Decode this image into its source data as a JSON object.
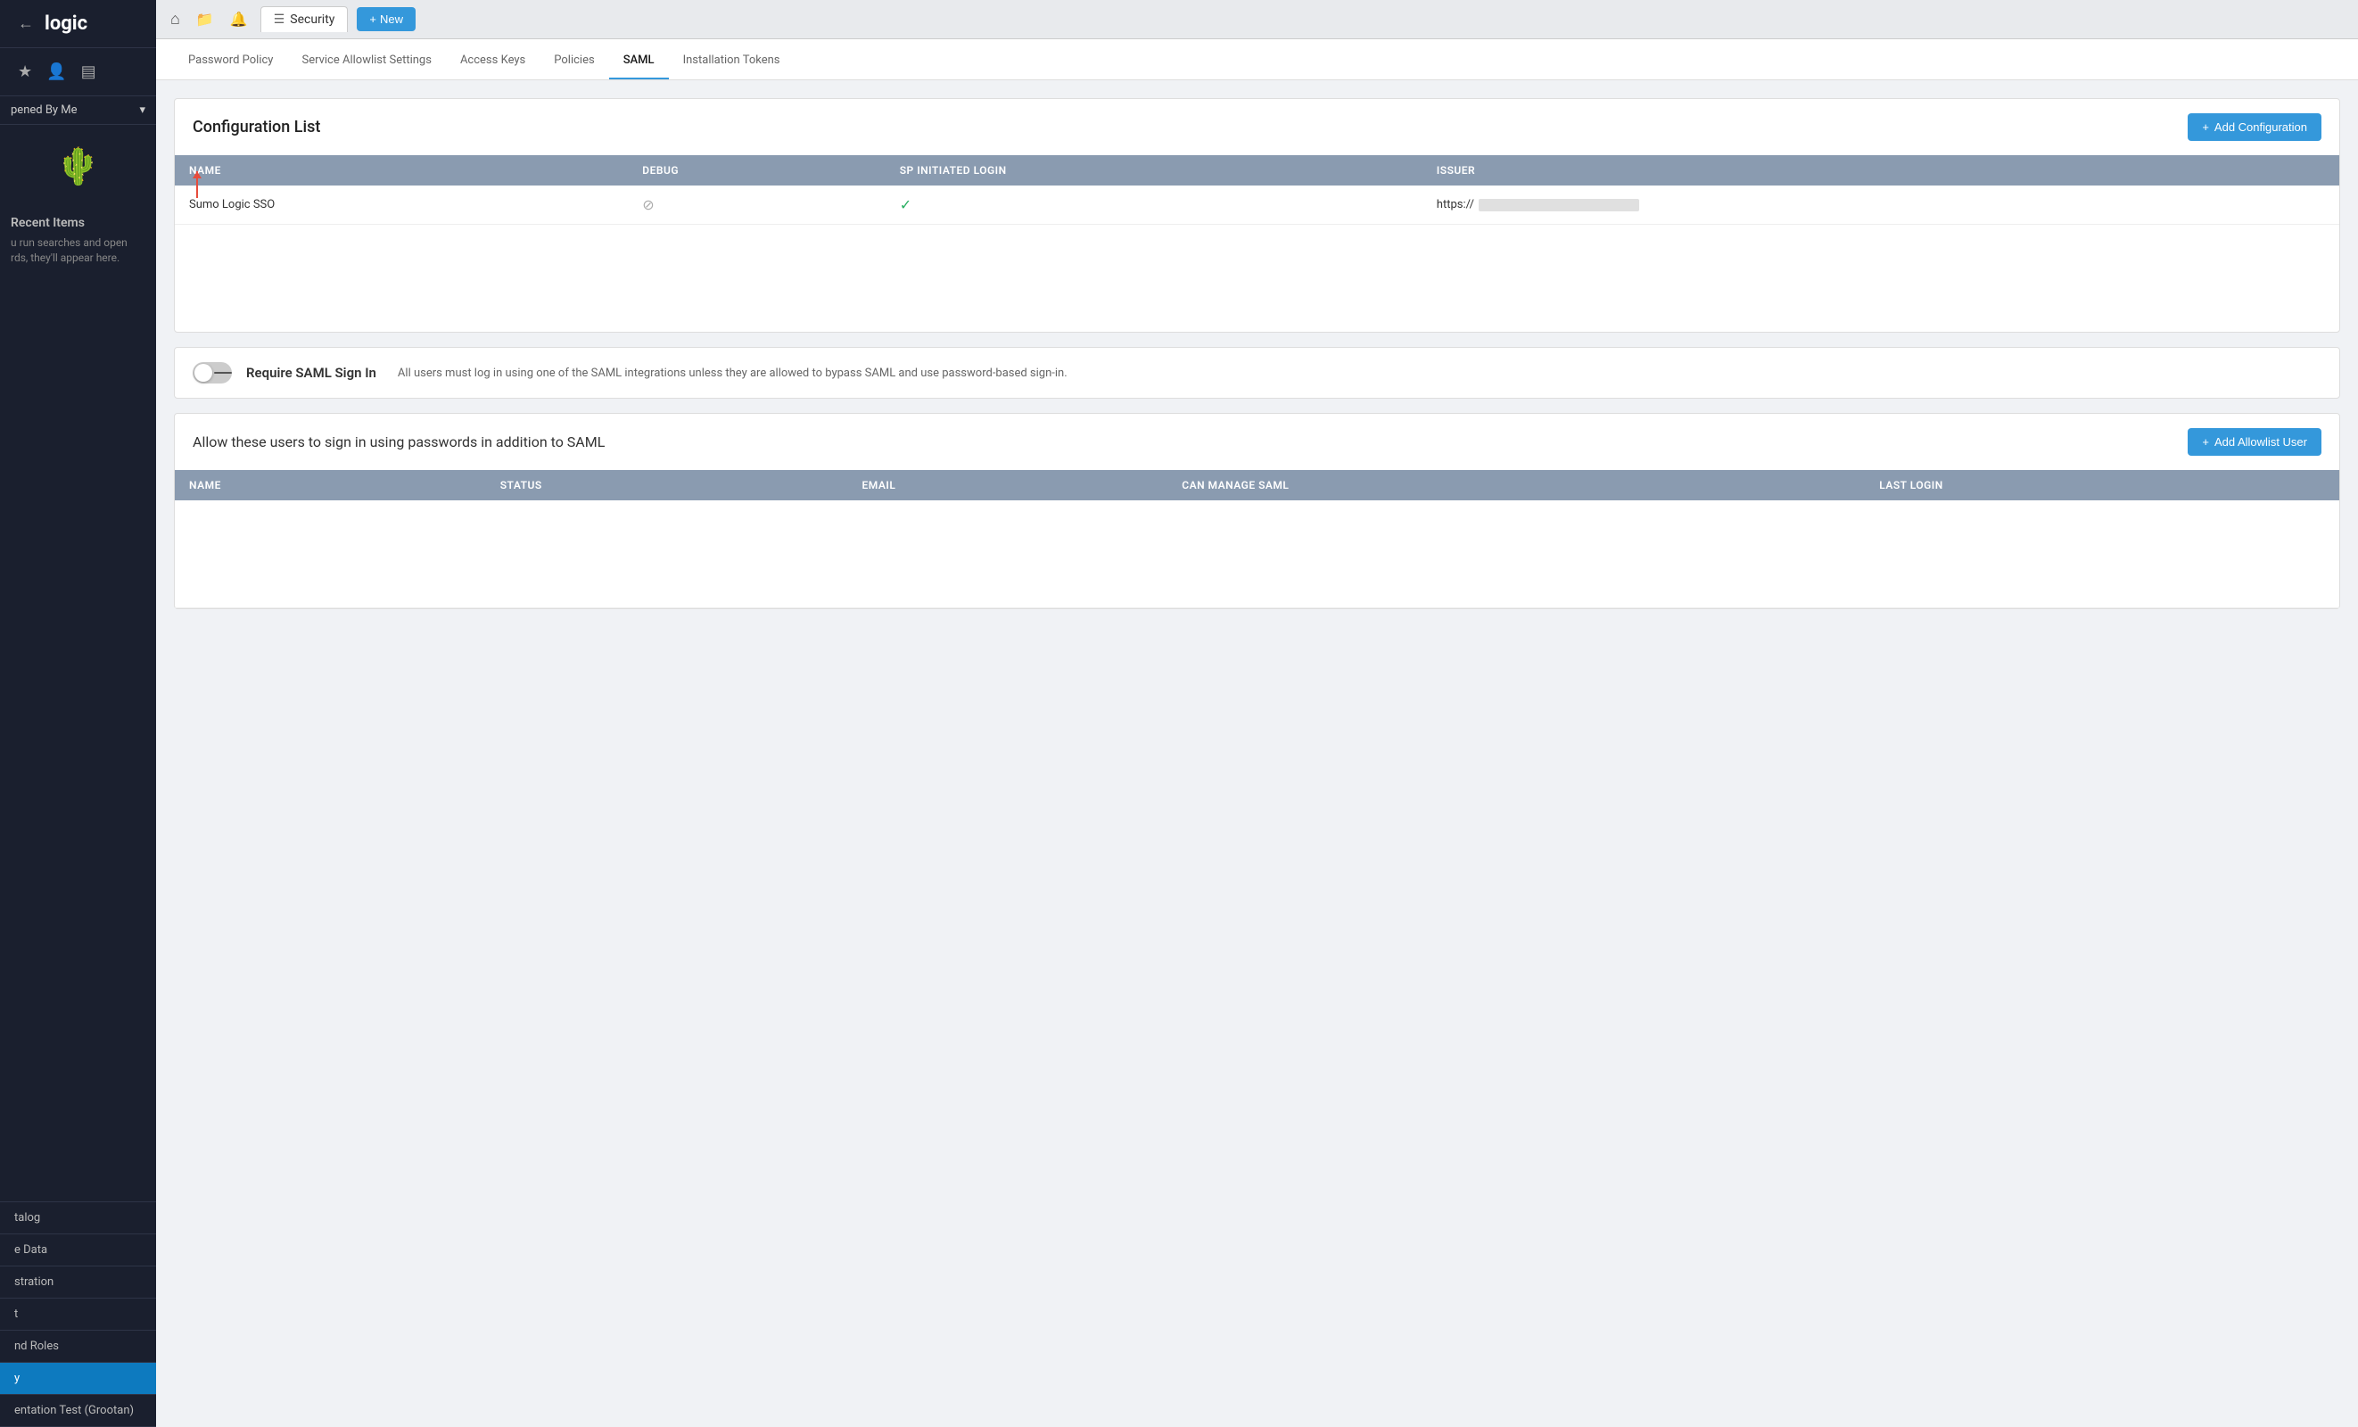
{
  "sidebar": {
    "logo_text": "logic",
    "dropdown_label": "pened By Me",
    "recent_items_title": "Recent Items",
    "recent_items_desc": "u run searches and open rds, they'll appear here.",
    "nav_items": [
      {
        "id": "catalog",
        "label": "talog",
        "active": false
      },
      {
        "id": "data",
        "label": "e Data",
        "active": false
      },
      {
        "id": "administration",
        "label": "stration",
        "active": false
      },
      {
        "id": "t",
        "label": "t",
        "active": false
      },
      {
        "id": "roles",
        "label": "nd Roles",
        "active": false
      },
      {
        "id": "security",
        "label": "y",
        "active": true
      },
      {
        "id": "test",
        "label": "entation Test (Grootan)",
        "active": false
      }
    ]
  },
  "topbar": {
    "tab_label": "Security",
    "new_button_label": "New"
  },
  "subnav": {
    "tabs": [
      {
        "id": "password-policy",
        "label": "Password Policy",
        "active": false
      },
      {
        "id": "service-allowlist",
        "label": "Service Allowlist Settings",
        "active": false
      },
      {
        "id": "access-keys",
        "label": "Access Keys",
        "active": false
      },
      {
        "id": "policies",
        "label": "Policies",
        "active": false
      },
      {
        "id": "saml",
        "label": "SAML",
        "active": true
      },
      {
        "id": "installation-tokens",
        "label": "Installation Tokens",
        "active": false
      }
    ]
  },
  "configuration_list": {
    "title": "Configuration List",
    "add_button_label": "Add Configuration",
    "columns": [
      "NAME",
      "DEBUG",
      "SP INITIATED LOGIN",
      "ISSUER"
    ],
    "rows": [
      {
        "name": "Sumo Logic SSO",
        "debug": "disabled",
        "sp_initiated_login": "enabled",
        "issuer_prefix": "https://"
      }
    ]
  },
  "require_saml": {
    "label": "Require SAML Sign In",
    "description": "All users must log in using one of the SAML integrations unless they are allowed to bypass SAML and use password-based sign-in.",
    "enabled": false
  },
  "allowlist": {
    "title": "Allow these users to sign in using passwords in addition to SAML",
    "add_button_label": "Add Allowlist User",
    "columns": [
      "NAME",
      "STATUS",
      "EMAIL",
      "CAN MANAGE SAML",
      "LAST LOGIN"
    ],
    "rows": []
  },
  "icons": {
    "home": "⌂",
    "files": "📁",
    "bell": "🔔",
    "star": "★",
    "person": "👤",
    "layers": "▤",
    "back": "←",
    "plus": "+",
    "chevron_down": "▾",
    "list": "☰"
  }
}
